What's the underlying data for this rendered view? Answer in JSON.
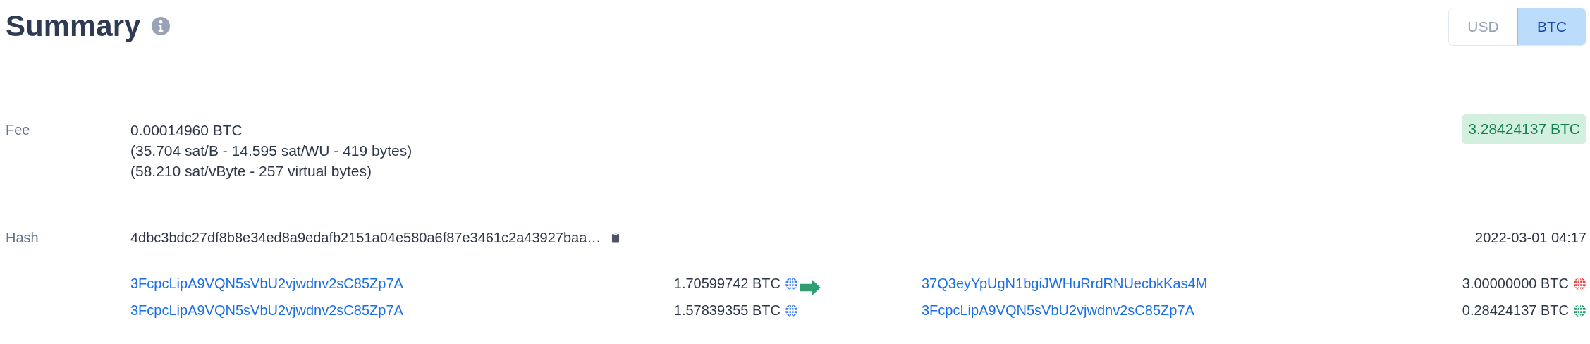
{
  "title": "Summary",
  "currency_toggle": [
    {
      "label": "USD",
      "selected": false
    },
    {
      "label": "BTC",
      "selected": true
    }
  ],
  "fee": {
    "label": "Fee",
    "lines": [
      "0.00014960 BTC",
      "(35.704 sat/B - 14.595 sat/WU - 419 bytes)",
      "(58.210 sat/vByte - 257 virtual bytes)"
    ],
    "total_badge": "3.28424137 BTC"
  },
  "hash": {
    "label": "Hash",
    "value": "4dbc3bdc27df8b8e34ed8a9edafb2151a04e580a6f87e3461c2a43927baa…",
    "time": "2022-03-01 04:17"
  },
  "inputs": [
    {
      "address": "3FcpcLipA9VQN5sVbU2vjwdnv2sC85Zp7A",
      "amount": "1.70599742 BTC",
      "color": "#3b82f6"
    },
    {
      "address": "3FcpcLipA9VQN5sVbU2vjwdnv2sC85Zp7A",
      "amount": "1.57839355 BTC",
      "color": "#3b82f6"
    }
  ],
  "outputs": [
    {
      "address": "37Q3eyYpUgN1bgiJWHuRrdRNUecbkKas4M",
      "amount": "3.00000000 BTC",
      "color": "#ef4444"
    },
    {
      "address": "3FcpcLipA9VQN5sVbU2vjwdnv2sC85Zp7A",
      "amount": "0.28424137 BTC",
      "color": "#22a06b"
    }
  ]
}
